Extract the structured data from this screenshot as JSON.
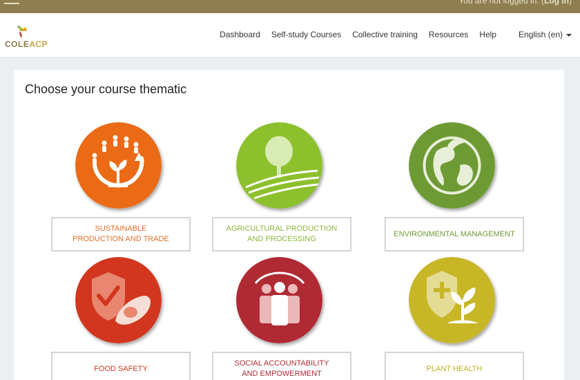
{
  "topbar": {
    "login_prefix": "You are not logged in. (",
    "login_link": "Log in",
    "login_suffix": ")"
  },
  "brand": {
    "part1": "COLE",
    "part2": "ACP"
  },
  "nav": {
    "items": [
      "Dashboard",
      "Self-study Courses",
      "Collective training",
      "Resources",
      "Help",
      "English (en)"
    ]
  },
  "main": {
    "title": "Choose your course thematic",
    "thematics": [
      {
        "label": "SUSTAINABLE\nPRODUCTION AND TRADE",
        "color": "#ea6a16",
        "text_color": "#e0712a"
      },
      {
        "label": "AGRICULTURAL PRODUCTION\nAND PROCESSING",
        "color": "#8dc02d",
        "text_color": "#8ab83a"
      },
      {
        "label": "ENVIRONMENTAL MANAGEMENT",
        "color": "#6e9a34",
        "text_color": "#6c9a34"
      },
      {
        "label": "FOOD SAFETY",
        "color": "#d2361e",
        "text_color": "#cf3c25"
      },
      {
        "label": "SOCIAL ACCOUNTABILITY\nAND EMPOWERMENT",
        "color": "#b02a34",
        "text_color": "#b02a34"
      },
      {
        "label": "PLANT HEALTH",
        "color": "#c7b727",
        "text_color": "#c0b02a"
      }
    ]
  }
}
